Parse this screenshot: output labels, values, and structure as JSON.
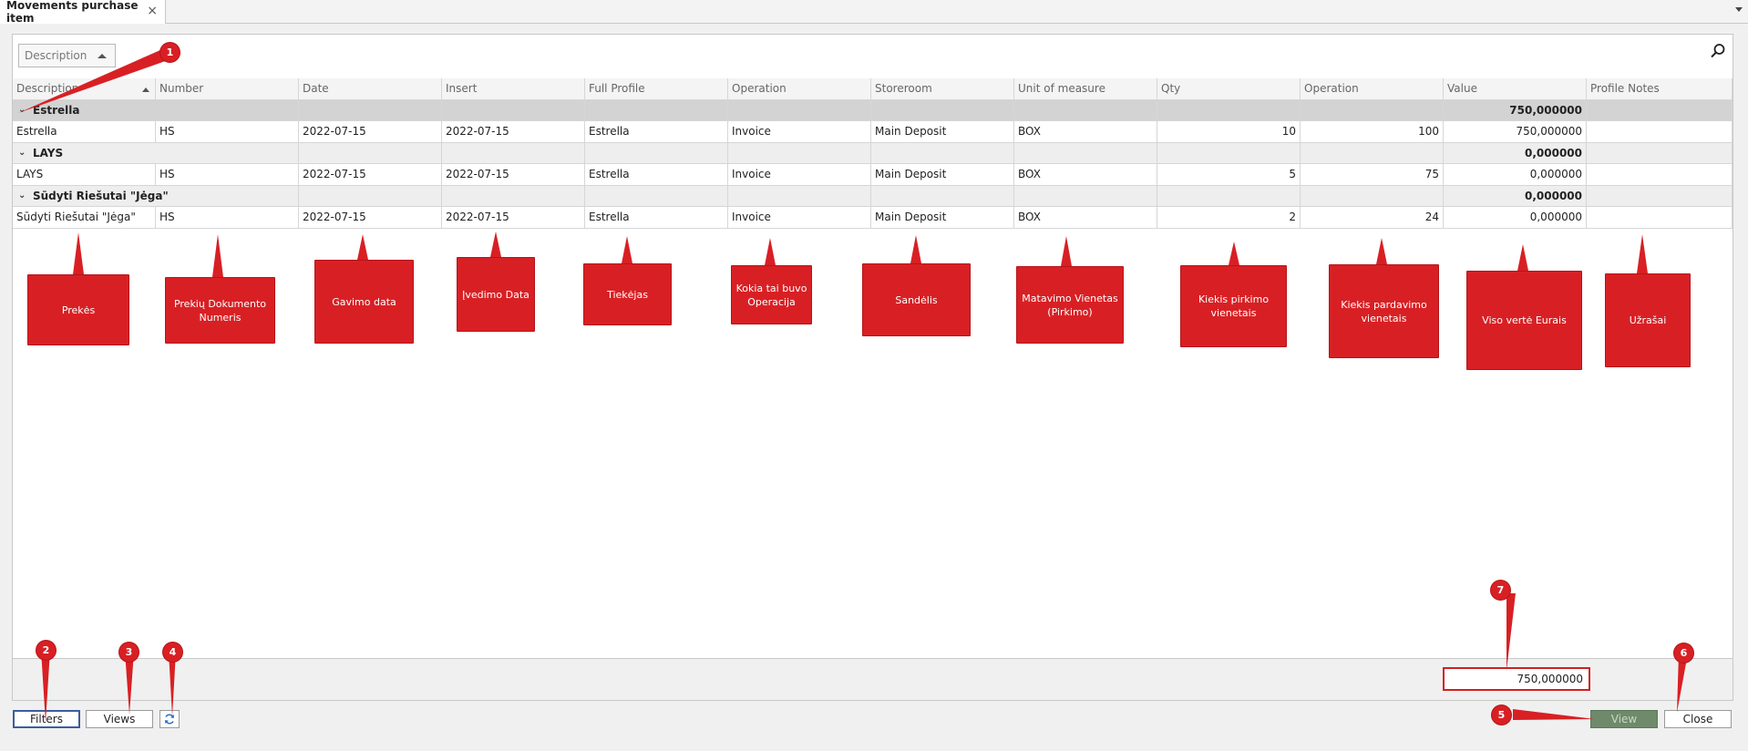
{
  "tab": {
    "title": "Movements purchase item",
    "close": "×"
  },
  "groupby": {
    "label": "Description"
  },
  "columns": [
    "Description",
    "Number",
    "Date",
    "Insert",
    "Full Profile",
    "Operation",
    "Storeroom",
    "Unit of measure",
    "Qty",
    "Operation",
    "Value",
    "Profile Notes"
  ],
  "groups": [
    {
      "label": "Estrella",
      "total": "750,000000",
      "row": [
        "Estrella",
        "HS",
        "2022-07-15",
        "2022-07-15",
        "Estrella",
        "Invoice",
        "Main Deposit",
        "BOX",
        "10",
        "100",
        "750,000000",
        ""
      ]
    },
    {
      "label": "LAYS",
      "total": "0,000000",
      "row": [
        "LAYS",
        "HS",
        "2022-07-15",
        "2022-07-15",
        "Estrella",
        "Invoice",
        "Main Deposit",
        "BOX",
        "5",
        "75",
        "0,000000",
        ""
      ]
    },
    {
      "label": "Sūdyti Riešutai \"Jėga\"",
      "total": "0,000000",
      "row": [
        "Sūdyti Riešutai \"Jėga\"",
        "HS",
        "2022-07-15",
        "2022-07-15",
        "Estrella",
        "Invoice",
        "Main Deposit",
        "BOX",
        "2",
        "24",
        "0,000000",
        ""
      ]
    }
  ],
  "footer_total": "750,000000",
  "buttons": {
    "filters": "Filters",
    "views": "Views",
    "view": "View",
    "close": "Close"
  },
  "callouts": [
    "Prekės",
    "Prekių Dokumento Numeris",
    "Gavimo data",
    "Įvedimo Data",
    "Tiekėjas",
    "Kokia tai buvo Operacija",
    "Sandėlis",
    "Matavimo Vienetas (Pirkimo)",
    "Kiekis pirkimo vienetais",
    "Kiekis pardavimo vienetais",
    "Viso vertė Eurais",
    "Užrašai"
  ],
  "markers": [
    "1",
    "2",
    "3",
    "4",
    "5",
    "6",
    "7"
  ],
  "colors": {
    "annotation": "#d82024",
    "view_button": "#6f8a6b",
    "focus_border": "#3b5e9d"
  }
}
